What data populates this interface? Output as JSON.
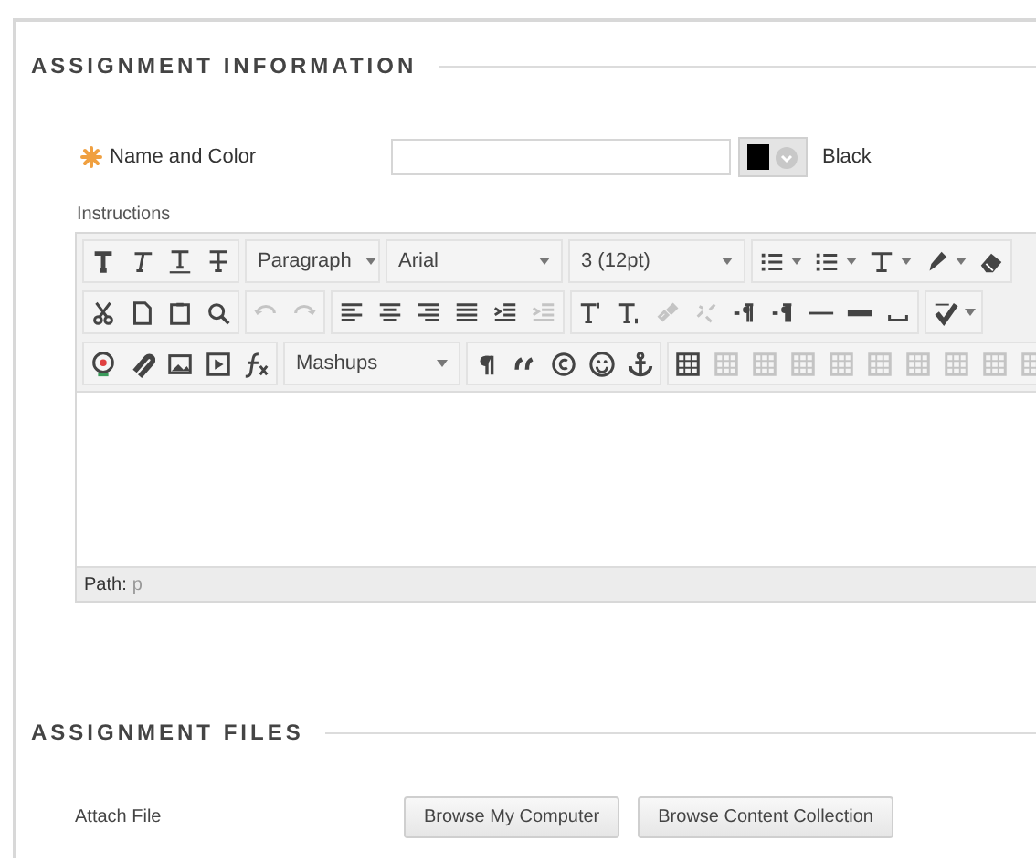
{
  "sections": [
    {
      "title": "ASSIGNMENT INFORMATION"
    },
    {
      "title": "ASSIGNMENT FILES"
    }
  ],
  "name_field": {
    "label": "Name and Color",
    "required": true,
    "color": "#000000",
    "color_name": "Black"
  },
  "instructions": {
    "label": "Instructions",
    "toolbar": [
      [
        {
          "items": [
            {
              "kind": "icon",
              "disabled": false
            },
            {
              "kind": "icon",
              "disabled": false
            },
            {
              "kind": "icon",
              "disabled": false
            },
            {
              "kind": "icon",
              "disabled": false
            }
          ]
        },
        {
          "items": [
            {
              "kind": "dropdown",
              "label": "Paragraph"
            }
          ]
        },
        {
          "items": [
            {
              "kind": "dropdown",
              "label": "Arial"
            }
          ]
        },
        {
          "items": [
            {
              "kind": "dropdown",
              "label": "3 (12pt)"
            }
          ]
        },
        {
          "items": [
            {
              "kind": "icon",
              "disabled": false,
              "menu": true
            },
            {
              "kind": "icon",
              "disabled": false,
              "menu": true
            },
            {
              "kind": "icon",
              "disabled": false,
              "menu": true
            },
            {
              "kind": "icon",
              "disabled": false,
              "menu": true
            },
            {
              "kind": "icon",
              "disabled": false
            }
          ]
        }
      ],
      [
        {
          "items": [
            {
              "kind": "icon",
              "disabled": false
            },
            {
              "kind": "icon",
              "disabled": false
            },
            {
              "kind": "icon",
              "disabled": false
            },
            {
              "kind": "icon",
              "disabled": false
            }
          ]
        },
        {
          "items": [
            {
              "kind": "icon",
              "disabled": true
            },
            {
              "kind": "icon",
              "disabled": true
            }
          ]
        },
        {
          "items": [
            {
              "kind": "icon",
              "disabled": false
            },
            {
              "kind": "icon",
              "disabled": false
            },
            {
              "kind": "icon",
              "disabled": false
            },
            {
              "kind": "icon",
              "disabled": false
            },
            {
              "kind": "icon",
              "disabled": false
            },
            {
              "kind": "icon",
              "disabled": true
            }
          ]
        },
        {
          "items": [
            {
              "kind": "icon",
              "disabled": false
            },
            {
              "kind": "icon",
              "disabled": false
            },
            {
              "kind": "icon",
              "disabled": true
            },
            {
              "kind": "icon",
              "disabled": true
            },
            {
              "kind": "icon",
              "disabled": false
            },
            {
              "kind": "icon",
              "disabled": false
            },
            {
              "kind": "icon",
              "disabled": false
            },
            {
              "kind": "icon",
              "disabled": false
            },
            {
              "kind": "icon",
              "disabled": false
            }
          ]
        },
        {
          "items": [
            {
              "kind": "icon",
              "disabled": false,
              "menu": true
            }
          ]
        }
      ],
      [
        {
          "items": [
            {
              "kind": "icon",
              "disabled": false
            },
            {
              "kind": "icon",
              "disabled": false
            },
            {
              "kind": "icon",
              "disabled": false
            },
            {
              "kind": "icon",
              "disabled": false
            },
            {
              "kind": "icon",
              "disabled": false
            }
          ]
        },
        {
          "items": [
            {
              "kind": "dropdown",
              "label": "Mashups"
            }
          ]
        },
        {
          "items": [
            {
              "kind": "icon",
              "disabled": false
            },
            {
              "kind": "icon",
              "disabled": false
            },
            {
              "kind": "icon",
              "disabled": false
            },
            {
              "kind": "icon",
              "disabled": false
            },
            {
              "kind": "icon",
              "disabled": false
            }
          ]
        },
        {
          "items": [
            {
              "kind": "icon",
              "disabled": false
            },
            {
              "kind": "icon",
              "disabled": true
            },
            {
              "kind": "icon",
              "disabled": true
            },
            {
              "kind": "icon",
              "disabled": true
            },
            {
              "kind": "icon",
              "disabled": true
            },
            {
              "kind": "icon",
              "disabled": true
            },
            {
              "kind": "icon",
              "disabled": true
            },
            {
              "kind": "icon",
              "disabled": true
            },
            {
              "kind": "icon",
              "disabled": true
            },
            {
              "kind": "icon",
              "disabled": true
            }
          ]
        }
      ]
    ],
    "path_label": "Path:",
    "path_value": "p"
  },
  "attach": {
    "label": "Attach File",
    "buttons": [
      "Browse My Computer",
      "Browse Content Collection"
    ]
  }
}
